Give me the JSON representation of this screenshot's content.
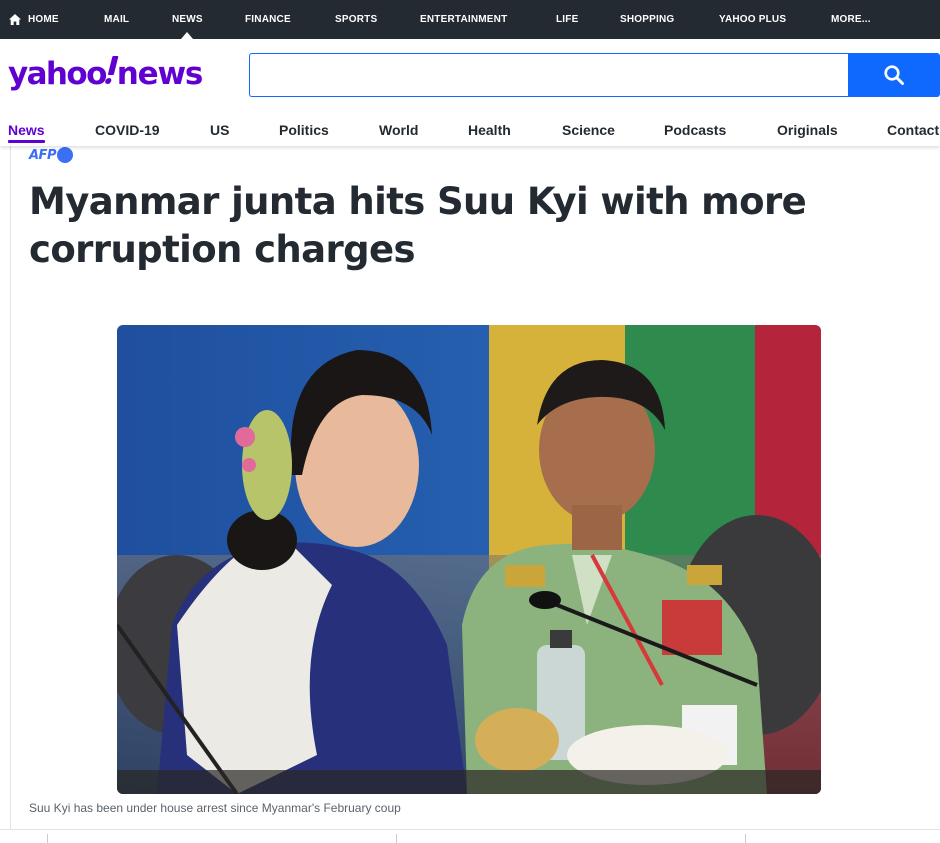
{
  "top_nav": {
    "items": [
      {
        "label": "HOME",
        "icon": "home-icon"
      },
      {
        "label": "MAIL"
      },
      {
        "label": "NEWS",
        "active": true
      },
      {
        "label": "FINANCE"
      },
      {
        "label": "SPORTS"
      },
      {
        "label": "ENTERTAINMENT"
      },
      {
        "label": "LIFE"
      },
      {
        "label": "SHOPPING"
      },
      {
        "label": "YAHOO PLUS"
      },
      {
        "label": "MORE..."
      }
    ]
  },
  "header": {
    "logo_yahoo": "yahoo",
    "logo_news": "news",
    "search_value": "",
    "search_placeholder": "",
    "search_icon": "search-icon"
  },
  "section_nav": {
    "items": [
      {
        "label": "News",
        "active": true
      },
      {
        "label": "COVID-19"
      },
      {
        "label": "US"
      },
      {
        "label": "Politics"
      },
      {
        "label": "World"
      },
      {
        "label": "Health"
      },
      {
        "label": "Science"
      },
      {
        "label": "Podcasts"
      },
      {
        "label": "Originals"
      },
      {
        "label": "Contact"
      }
    ]
  },
  "article": {
    "source": "AFP",
    "headline": "Myanmar junta hits Suu Kyi with more corruption charges",
    "caption": "Suu Kyi has been under house arrest since Myanmar's February coup"
  },
  "colors": {
    "top_bar": "#232a31",
    "brand_purple": "#6001d2",
    "search_blue": "#0f69ff",
    "afp_blue": "#3b6ff5"
  }
}
